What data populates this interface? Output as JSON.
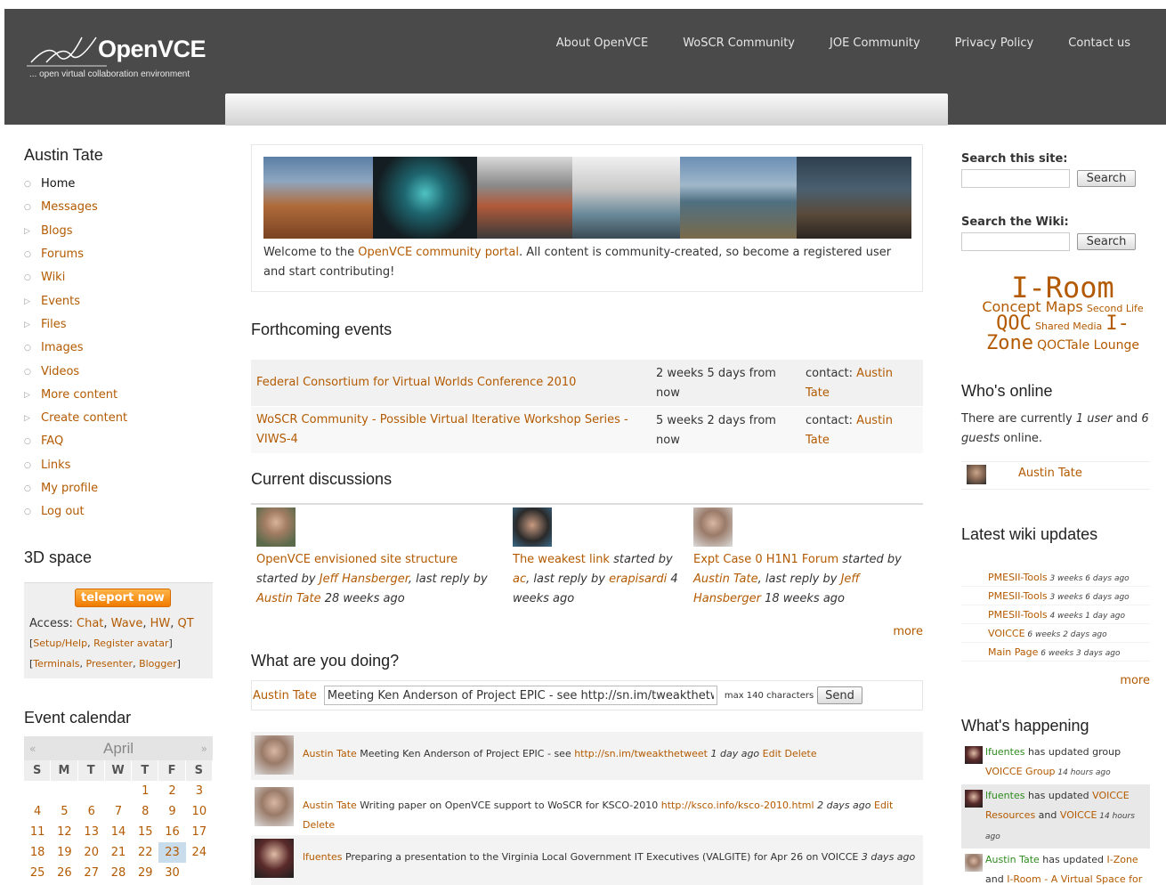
{
  "header": {
    "logo_text": "OpenVCE",
    "tagline": "... open virtual collaboration environment",
    "nav": [
      "About OpenVCE",
      "WoSCR Community",
      "JOE Community",
      "Privacy Policy",
      "Contact us"
    ]
  },
  "left": {
    "user_title": "Austin Tate",
    "menu": [
      {
        "label": "Home",
        "type": "leaf",
        "active": true
      },
      {
        "label": "Messages",
        "type": "leaf"
      },
      {
        "label": "Blogs",
        "type": "collapsed"
      },
      {
        "label": "Forums",
        "type": "leaf"
      },
      {
        "label": "Wiki",
        "type": "leaf"
      },
      {
        "label": "Events",
        "type": "collapsed"
      },
      {
        "label": "Files",
        "type": "collapsed"
      },
      {
        "label": "Images",
        "type": "leaf"
      },
      {
        "label": "Videos",
        "type": "leaf"
      },
      {
        "label": "More content",
        "type": "collapsed"
      },
      {
        "label": "Create content",
        "type": "collapsed"
      },
      {
        "label": "FAQ",
        "type": "leaf"
      },
      {
        "label": "Links",
        "type": "leaf"
      },
      {
        "label": "My profile",
        "type": "leaf"
      },
      {
        "label": "Log out",
        "type": "leaf"
      }
    ],
    "space_title": "3D space",
    "teleport": "teleport now",
    "access_label": "Access: ",
    "access_links": [
      "Chat",
      "Wave",
      "HW",
      "QT"
    ],
    "setup_links": [
      "Setup/Help",
      "Register avatar"
    ],
    "terminal_links": [
      "Terminals",
      "Presenter",
      "Blogger"
    ],
    "calendar": {
      "title": "Event calendar",
      "prev": "«",
      "next": "»",
      "month": "April",
      "dow": [
        "S",
        "M",
        "T",
        "W",
        "T",
        "F",
        "S"
      ],
      "weeks": [
        [
          "",
          "",
          "",
          "",
          "1",
          "2",
          "3"
        ],
        [
          "4",
          "5",
          "6",
          "7",
          "8",
          "9",
          "10"
        ],
        [
          "11",
          "12",
          "13",
          "14",
          "15",
          "16",
          "17"
        ],
        [
          "18",
          "19",
          "20",
          "21",
          "22",
          "23",
          "24"
        ],
        [
          "25",
          "26",
          "27",
          "28",
          "29",
          "30",
          ""
        ]
      ],
      "today": "23"
    }
  },
  "main": {
    "welcome_prefix": "Welcome to the ",
    "welcome_link": "OpenVCE community portal",
    "welcome_suffix": ". All content is community-created, so become a registered user and start contributing!",
    "events_title": "Forthcoming events",
    "events": [
      {
        "name": "Federal Consortium for Virtual Worlds Conference 2010",
        "when": "2 weeks 5 days from now",
        "contact_label": "contact: ",
        "contact": "Austin Tate"
      },
      {
        "name": "WoSCR Community - Possible Virtual Iterative Workshop Series - VIWS-4",
        "when": "5 weeks 2 days from now",
        "contact_label": "contact: ",
        "contact": "Austin Tate"
      }
    ],
    "discussions_title": "Current discussions",
    "discussions": [
      {
        "title": "OpenVCE envisioned site structure",
        "started_label": " started by ",
        "starter": "Jeff Hansberger",
        "reply_label": ", last reply by ",
        "replier": "Austin Tate",
        "ago": " 28 weeks ago"
      },
      {
        "title": "The weakest link",
        "started_label": " started by ",
        "starter": "ac",
        "reply_label": ", last reply by ",
        "replier": "erapisardi",
        "ago": " 4 weeks ago"
      },
      {
        "title": "Expt Case 0 H1N1 Forum",
        "started_label": " started by ",
        "starter": "Austin Tate",
        "reply_label": ", last reply by ",
        "replier": "Jeff Hansberger",
        "ago": " 18 weeks ago"
      }
    ],
    "discussions_more": "more",
    "doing_title": "What are you doing?",
    "status_user": "Austin Tate",
    "status_value": "Meeting Ken Anderson of Project EPIC - see http://sn.im/tweakthetweet",
    "status_max": "max 140 characters",
    "send_label": "Send",
    "statuses": [
      {
        "user": "Austin Tate",
        "text": " Meeting Ken Anderson of Project EPIC - see ",
        "link": "http://sn.im/tweakthetweet",
        "ago": " 1 day ago ",
        "edit": "Edit",
        "delete": "Delete"
      },
      {
        "user": "Austin Tate",
        "text": " Writing paper on OpenVCE support to WoSCR for KSCO-2010 ",
        "link": "http://ksco.info/ksco-2010.html",
        "ago": " 2 days ago ",
        "edit": "Edit",
        "delete": "Delete"
      },
      {
        "user": "lfuentes",
        "text": " Preparing a presentation to the Virginia Local Government IT Executives (VALGITE) for Apr 26 on VOICCE ",
        "link": "",
        "ago": "3 days ago",
        "edit": "",
        "delete": ""
      }
    ]
  },
  "right": {
    "search_site_label": "Search this site:",
    "search_wiki_label": "Search the Wiki:",
    "search_btn": "Search",
    "cloud": [
      "I-Room",
      "Concept Maps",
      "Second Life",
      "QOC",
      "Shared Media",
      "I-Zone",
      "QOCTale Lounge"
    ],
    "online_title": "Who's online",
    "online_prefix": "There are currently ",
    "online_users": "1 user",
    "online_and": " and ",
    "online_guests": "6 guests",
    "online_suffix": " online.",
    "online_user": "Austin Tate",
    "wiki_title": "Latest wiki updates",
    "wiki": [
      {
        "page": "PMESII-Tools",
        "ago": " 3 weeks 6 days ago"
      },
      {
        "page": "PMESII-Tools",
        "ago": " 3 weeks 6 days ago"
      },
      {
        "page": "PMESII-Tools",
        "ago": " 4 weeks 1 day ago"
      },
      {
        "page": "VOICCE",
        "ago": " 6 weeks 2 days ago"
      },
      {
        "page": "Main Page",
        "ago": " 6 weeks 3 days ago"
      }
    ],
    "wiki_more": "more",
    "happening_title": "What's happening",
    "happening": [
      {
        "user": "lfuentes",
        "action": " has updated group ",
        "target": "VOICCE Group",
        "ago": " 14 hours ago"
      },
      {
        "user": "lfuentes",
        "action": " has updated ",
        "target": "VOICCE Resources",
        "and": " and ",
        "target2": "VOICCE",
        "ago": " 14 hours ago"
      },
      {
        "user": "Austin Tate",
        "action": " has updated ",
        "target": "I-Zone",
        "and": " and ",
        "target2": "I-Room - A Virtual Space for",
        "ago": ""
      }
    ]
  },
  "colors": {
    "header_bg": "#4a4a4a",
    "link": "#b35a00",
    "green_user": "#2e8b1e",
    "teleport": "#f07a00"
  }
}
